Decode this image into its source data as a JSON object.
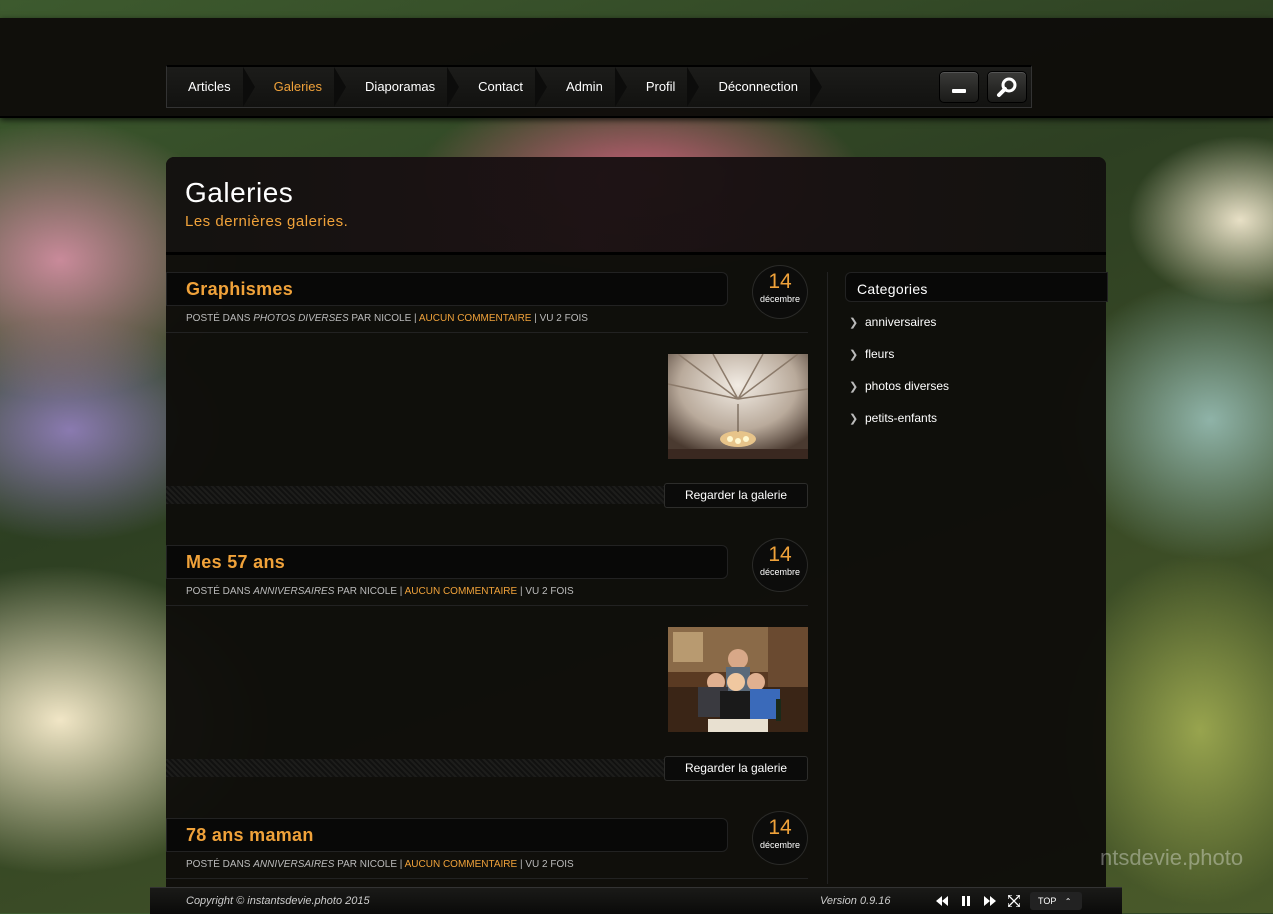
{
  "nav": {
    "items": [
      {
        "label": "Articles",
        "active": false
      },
      {
        "label": "Galeries",
        "active": true
      },
      {
        "label": "Diaporamas",
        "active": false
      },
      {
        "label": "Contact",
        "active": false
      },
      {
        "label": "Admin",
        "active": false
      },
      {
        "label": "Profil",
        "active": false
      },
      {
        "label": "Déconnection",
        "active": false
      }
    ],
    "buttons": [
      "minimize-icon",
      "search-icon"
    ]
  },
  "page": {
    "title": "Galeries",
    "subtitle": "Les dernières galeries."
  },
  "posts": [
    {
      "title": "Graphismes",
      "day": "14",
      "month": "décembre",
      "meta_prefix": "POSTÉ DANS ",
      "category": "PHOTOS DIVERSES",
      "author": " PAR NICOLE | ",
      "comments": "AUCUN COMMENTAIRE",
      "views": " | VU 2 FOIS",
      "button": "Regarder la galerie"
    },
    {
      "title": "Mes 57 ans",
      "day": "14",
      "month": "décembre",
      "meta_prefix": "POSTÉ DANS ",
      "category": "ANNIVERSAIRES",
      "author": " PAR NICOLE | ",
      "comments": "AUCUN COMMENTAIRE",
      "views": " | VU 2 FOIS",
      "button": "Regarder la galerie"
    },
    {
      "title": "78 ans maman",
      "day": "14",
      "month": "décembre",
      "meta_prefix": "POSTÉ DANS ",
      "category": "ANNIVERSAIRES",
      "author": " PAR NICOLE | ",
      "comments": "AUCUN COMMENTAIRE",
      "views": " | VU 2 FOIS"
    }
  ],
  "sidebar": {
    "title": "Categories",
    "items": [
      "anniversaires",
      "fleurs",
      "photos diverses",
      "petits-enfants"
    ]
  },
  "footer": {
    "copyright": "Copyright © instantsdevie.photo 2015",
    "version": "Version 0.9.16",
    "top": "TOP",
    "watermark": "ntsdevie.photo"
  },
  "colors": {
    "accent": "#f0a23a",
    "panel": "#0e0d0a"
  }
}
